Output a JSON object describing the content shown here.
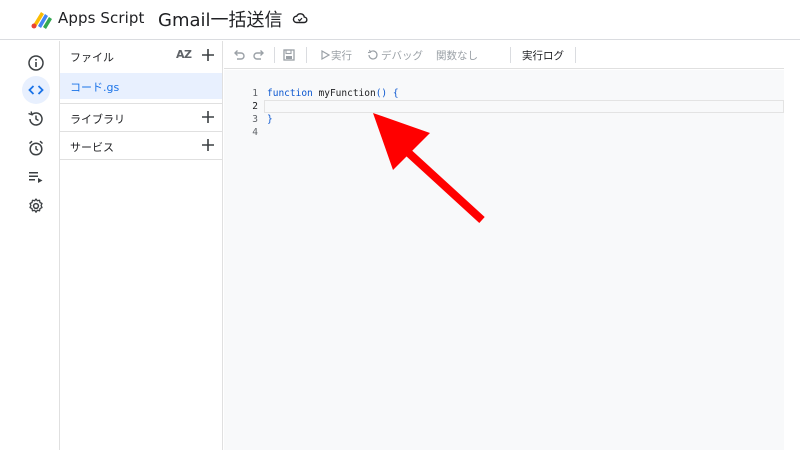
{
  "header": {
    "app_name": "Apps Script",
    "project_title": "Gmail一括送信"
  },
  "rail": {
    "items": [
      {
        "name": "overview",
        "icon": "info-icon"
      },
      {
        "name": "editor",
        "icon": "code-icon",
        "active": true
      },
      {
        "name": "versions",
        "icon": "history-icon"
      },
      {
        "name": "triggers",
        "icon": "alarm-icon"
      },
      {
        "name": "executions",
        "icon": "playlist-icon"
      },
      {
        "name": "settings",
        "icon": "gear-icon"
      }
    ]
  },
  "files_panel": {
    "files_label": "ファイル",
    "sort_label": "AZ",
    "file_name": "コード.gs",
    "libraries_label": "ライブラリ",
    "services_label": "サービス"
  },
  "toolbar": {
    "run_label": "実行",
    "debug_label": "デバッグ",
    "function_select": "関数なし",
    "execution_log_label": "実行ログ"
  },
  "editor": {
    "line_numbers": [
      "1",
      "2",
      "3",
      "4"
    ],
    "code": {
      "line1_keyword": "function",
      "line1_name": "myFunction",
      "line1_parens": "()",
      "line1_brace": "{",
      "line3": "}"
    }
  },
  "colors": {
    "accent": "#1a73e8",
    "active_bg": "#e8f0fe",
    "annotation": "#ff0000"
  }
}
